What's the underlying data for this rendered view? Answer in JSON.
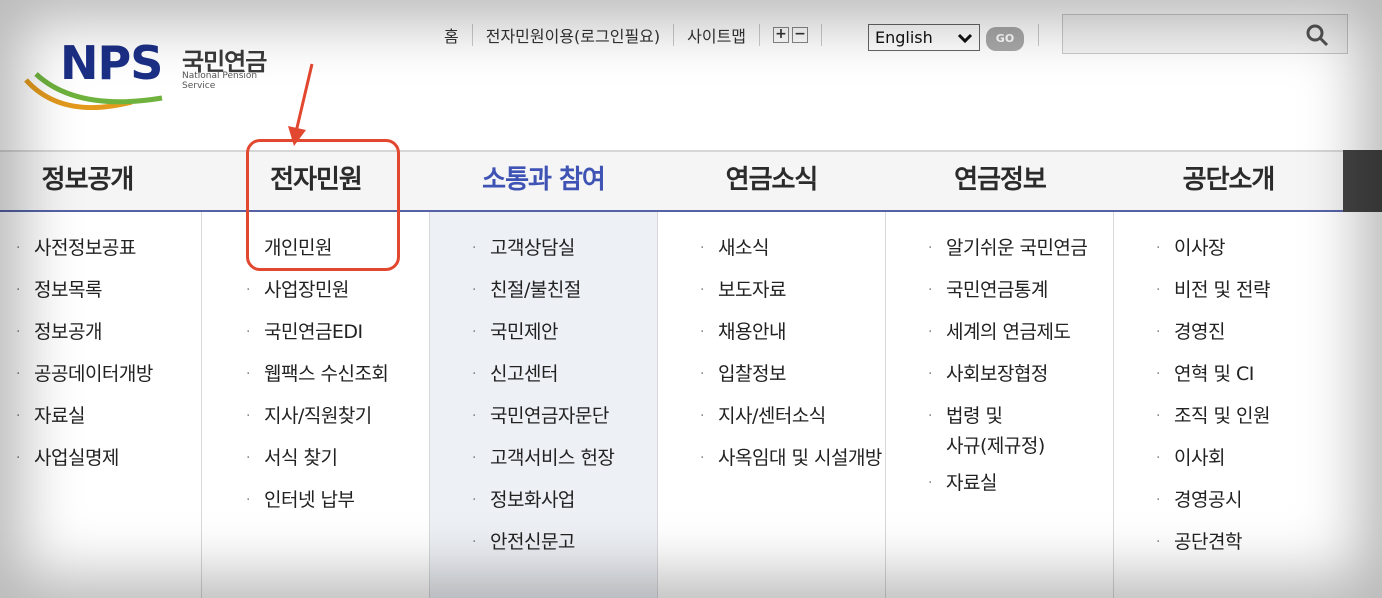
{
  "logo": {
    "brand": "NPS",
    "korean_name": "국민연금",
    "english_name": "National Pension Service"
  },
  "utility": {
    "home": "홈",
    "e_service": "전자민원이용(로그인필요)",
    "sitemap": "사이트맵",
    "zoom_in": "+",
    "zoom_out": "−",
    "language_selected": "English",
    "go_label": "GO"
  },
  "nav": {
    "items": [
      {
        "label": "정보공개"
      },
      {
        "label": "전자민원"
      },
      {
        "label": "소통과 참여"
      },
      {
        "label": "연금소식"
      },
      {
        "label": "연금정보"
      },
      {
        "label": "공단소개"
      }
    ]
  },
  "menus": {
    "col0": [
      "사전정보공표",
      "정보목록",
      "정보공개",
      "공공데이터개방",
      "자료실",
      "사업실명제"
    ],
    "col1": [
      "개인민원",
      "사업장민원",
      "국민연금EDI",
      "웹팩스 수신조회",
      "지사/직원찾기",
      "서식 찾기",
      "인터넷 납부"
    ],
    "col2": [
      "고객상담실",
      "친절/불친절",
      "국민제안",
      "신고센터",
      "국민연금자문단",
      "고객서비스 헌장",
      "정보화사업",
      "안전신문고"
    ],
    "col3": [
      "새소식",
      "보도자료",
      "채용안내",
      "입찰정보",
      "지사/센터소식",
      "사옥임대 및 시설개방"
    ],
    "col4": [
      "알기쉬운 국민연금",
      "국민연금통계",
      "세계의 연금제도",
      "사회보장협정",
      "법령 및\n사규(제규정)",
      "자료실"
    ],
    "col5": [
      "이사장",
      "비전 및 전략",
      "경영진",
      "연혁 및 CI",
      "조직 및 인원",
      "이사회",
      "경영공시",
      "공단견학"
    ]
  },
  "colors": {
    "active_nav": "#3f53b5",
    "annotation": "#e2472f",
    "brand_navy": "#1b2f86"
  }
}
